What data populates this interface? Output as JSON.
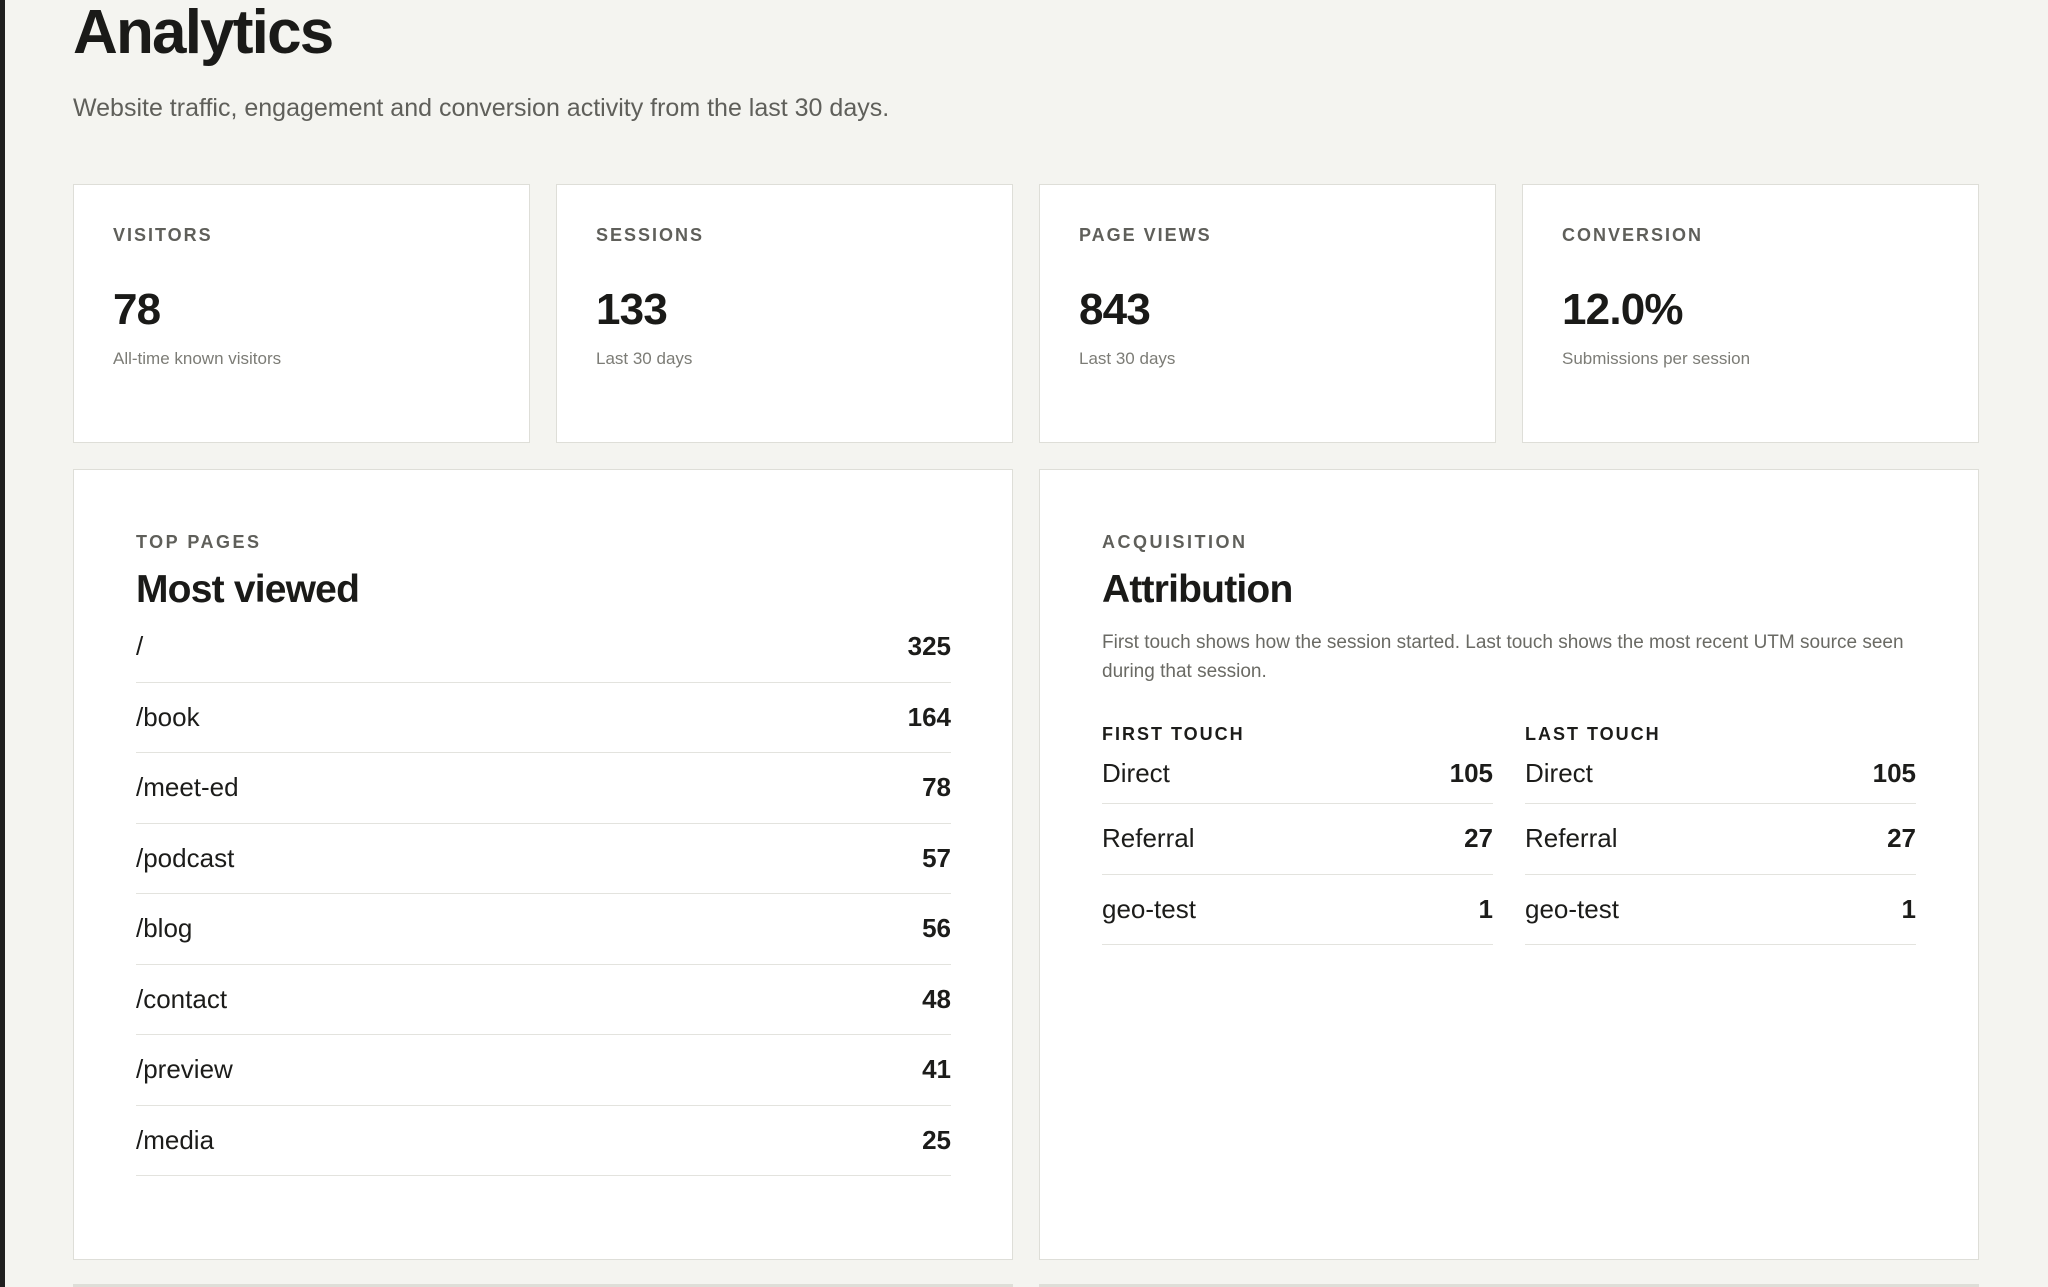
{
  "header": {
    "title": "Analytics",
    "subtitle": "Website traffic, engagement and conversion activity from the last 30 days."
  },
  "stats": [
    {
      "label": "VISITORS",
      "value": "78",
      "note": "All-time known visitors"
    },
    {
      "label": "SESSIONS",
      "value": "133",
      "note": "Last 30 days"
    },
    {
      "label": "PAGE VIEWS",
      "value": "843",
      "note": "Last 30 days"
    },
    {
      "label": "CONVERSION",
      "value": "12.0%",
      "note": "Submissions per session"
    }
  ],
  "top_pages": {
    "eyebrow": "TOP PAGES",
    "heading": "Most viewed",
    "rows": [
      {
        "path": "/",
        "views": "325"
      },
      {
        "path": "/book",
        "views": "164"
      },
      {
        "path": "/meet-ed",
        "views": "78"
      },
      {
        "path": "/podcast",
        "views": "57"
      },
      {
        "path": "/blog",
        "views": "56"
      },
      {
        "path": "/contact",
        "views": "48"
      },
      {
        "path": "/preview",
        "views": "41"
      },
      {
        "path": "/media",
        "views": "25"
      }
    ]
  },
  "acquisition": {
    "eyebrow": "ACQUISITION",
    "heading": "Attribution",
    "description": "First touch shows how the session started. Last touch shows the most recent UTM source seen during that session.",
    "first_touch": {
      "heading": "FIRST TOUCH",
      "rows": [
        {
          "source": "Direct",
          "count": "105"
        },
        {
          "source": "Referral",
          "count": "27"
        },
        {
          "source": "geo-test",
          "count": "1"
        }
      ]
    },
    "last_touch": {
      "heading": "LAST TOUCH",
      "rows": [
        {
          "source": "Direct",
          "count": "105"
        },
        {
          "source": "Referral",
          "count": "27"
        },
        {
          "source": "geo-test",
          "count": "1"
        }
      ]
    }
  }
}
